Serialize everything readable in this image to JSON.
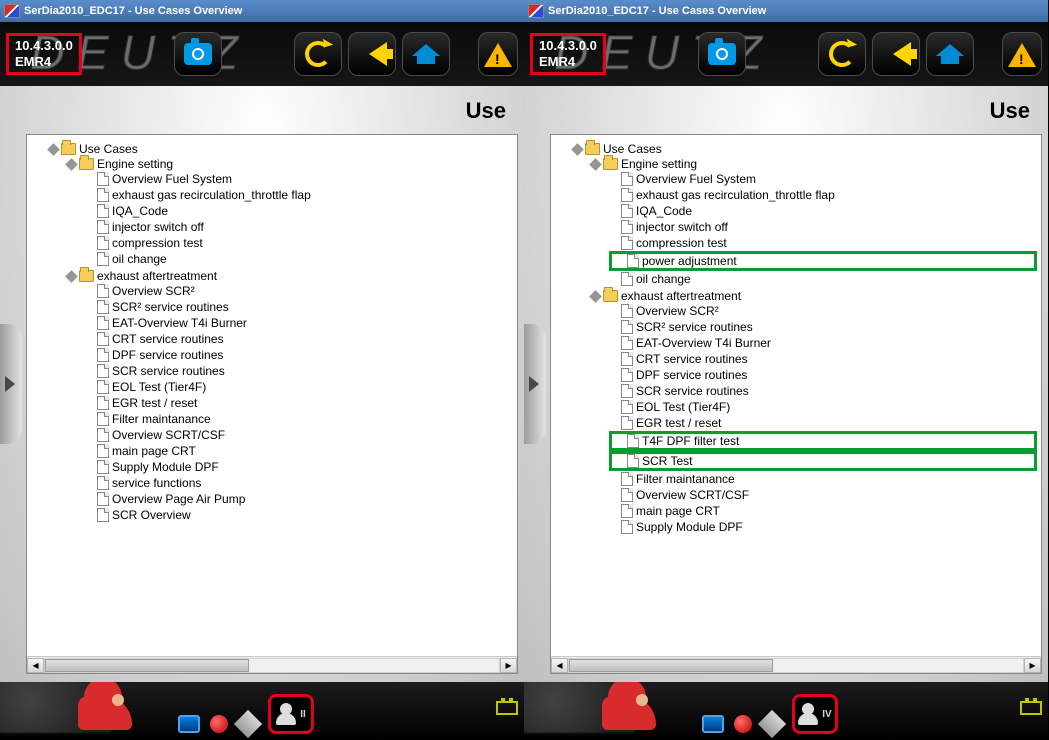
{
  "title": "SerDia2010_EDC17 - Use Cases Overview",
  "version": {
    "line1": "10.4.3.0.0",
    "line2": "EMR4"
  },
  "brand_bg": "DEUTZ",
  "content_title": "Use",
  "tree_left": {
    "root": "Use Cases",
    "groups": [
      {
        "label": "Engine setting",
        "items": [
          "Overview Fuel System",
          "exhaust gas recirculation_throttle flap",
          "IQA_Code",
          "injector switch off",
          "compression test",
          "oil change"
        ]
      },
      {
        "label": "exhaust aftertreatment",
        "items": [
          "Overview SCR²",
          "SCR² service routines",
          "EAT-Overview T4i Burner",
          "CRT service routines",
          "DPF service routines",
          "SCR service routines",
          "EOL Test (Tier4F)",
          "EGR test / reset",
          "Filter maintanance",
          "Overview SCRT/CSF",
          "main page CRT",
          "Supply Module DPF",
          "service functions",
          "Overview Page Air Pump",
          "SCR Overview"
        ]
      }
    ]
  },
  "tree_right": {
    "root": "Use Cases",
    "groups": [
      {
        "label": "Engine setting",
        "items": [
          "Overview Fuel System",
          "exhaust gas recirculation_throttle flap",
          "IQA_Code",
          "injector switch off",
          "compression test",
          {
            "text": "power adjustment",
            "hl": true
          },
          "oil change"
        ]
      },
      {
        "label": "exhaust aftertreatment",
        "items": [
          "Overview SCR²",
          "SCR² service routines",
          "EAT-Overview T4i Burner",
          "CRT service routines",
          "DPF service routines",
          "SCR service routines",
          "EOL Test (Tier4F)",
          "EGR test / reset",
          {
            "text": "T4F DPF filter test",
            "hl": true
          },
          {
            "text": "SCR Test",
            "hl": true
          },
          "Filter maintanance",
          "Overview SCRT/CSF",
          "main page CRT",
          "Supply Module DPF"
        ]
      }
    ]
  },
  "level_left": "II",
  "level_right": "IV"
}
